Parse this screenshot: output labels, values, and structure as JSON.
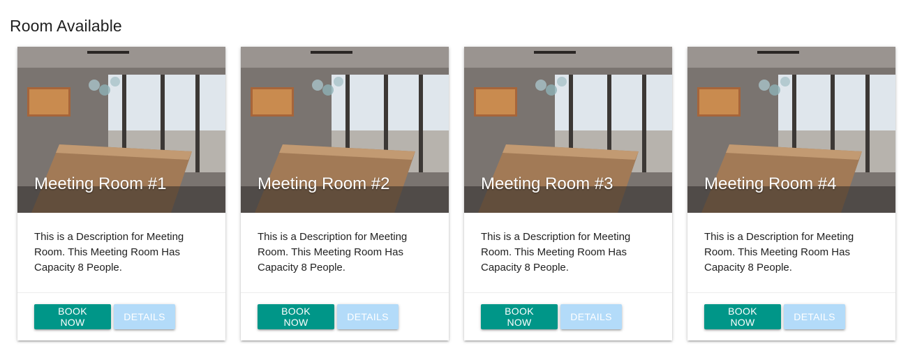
{
  "page": {
    "title": "Room Available"
  },
  "colors": {
    "book_button": "#009688",
    "details_button": "#b3dbf9"
  },
  "rooms": [
    {
      "title": "Meeting Room #1",
      "description": "This is a Description for Meeting Room. This Meeting Room Has Capacity 8 People.",
      "book_label": "BOOK NOW",
      "details_label": "DETAILS"
    },
    {
      "title": "Meeting Room #2",
      "description": "This is a Description for Meeting Room. This Meeting Room Has Capacity 8 People.",
      "book_label": "BOOK NOW",
      "details_label": "DETAILS"
    },
    {
      "title": "Meeting Room #3",
      "description": "This is a Description for Meeting Room. This Meeting Room Has Capacity 8 People.",
      "book_label": "BOOK NOW",
      "details_label": "DETAILS"
    },
    {
      "title": "Meeting Room #4",
      "description": "This is a Description for Meeting Room. This Meeting Room Has Capacity 8 People.",
      "book_label": "BOOK NOW",
      "details_label": "DETAILS"
    }
  ]
}
